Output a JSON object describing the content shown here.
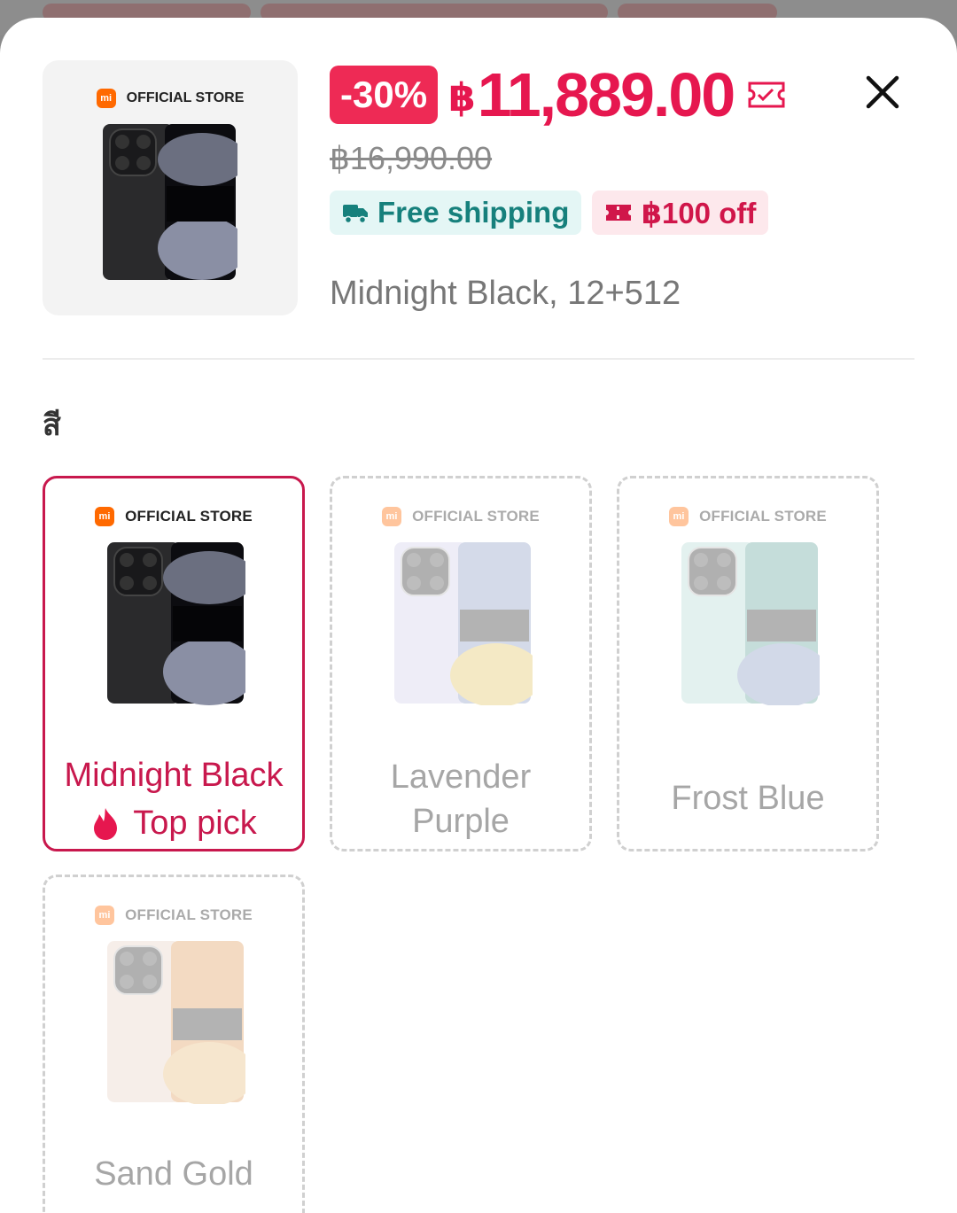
{
  "header": {
    "discount_badge": "-30%",
    "currency_symbol": "฿",
    "price": "11,889.00",
    "original_price": "฿16,990.00",
    "free_shipping_label": "Free shipping",
    "voucher_label": "฿100 off",
    "selected_variant": "Midnight Black, 12+512",
    "store_badge": "OFFICIAL STORE",
    "mi_logo_text": "mi"
  },
  "section": {
    "color_label": "สี"
  },
  "options": [
    {
      "label": "Midnight Black",
      "extra": "Top pick",
      "state": "selected",
      "phone_color": "black"
    },
    {
      "label": "Lavender\nPurple",
      "state": "unavailable",
      "phone_color": "lavender"
    },
    {
      "label": "Frost Blue",
      "state": "unavailable",
      "phone_color": "frost"
    },
    {
      "label": "Sand Gold",
      "state": "unavailable",
      "phone_color": "sand"
    }
  ],
  "colors": {
    "accent": "#e6174f",
    "selected_border": "#c8184d",
    "shipping_text": "#16807c",
    "shipping_bg": "#e4f6f5",
    "voucher_bg": "#fde8ec"
  }
}
